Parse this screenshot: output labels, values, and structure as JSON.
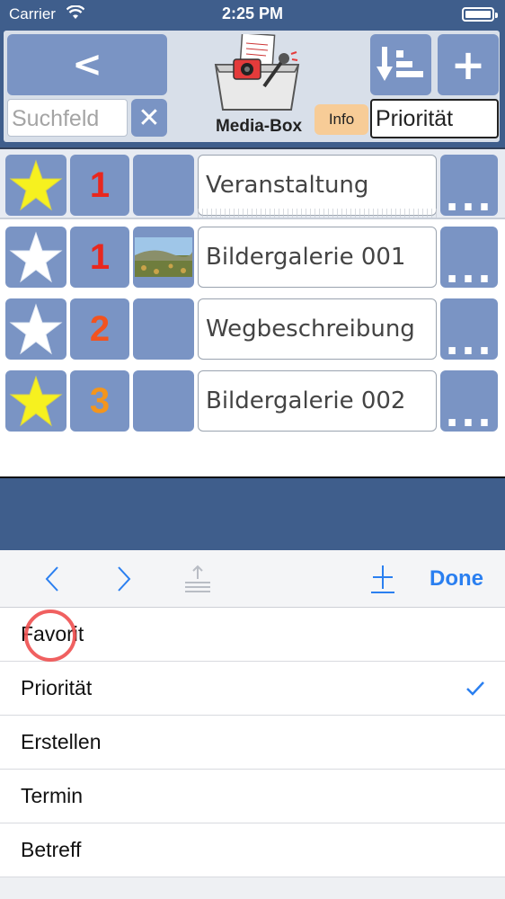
{
  "status_bar": {
    "carrier": "Carrier",
    "time": "2:25 PM"
  },
  "header": {
    "back_label": "<",
    "search_placeholder": "Suchfeld",
    "clear_label": "✕",
    "logo_caption": "Media-Box",
    "info_label": "Info",
    "add_label": "+",
    "sort_field_value": "Priorität"
  },
  "rows": [
    {
      "favorite": true,
      "priority": "1",
      "priority_color": "#e8271e",
      "has_image": false,
      "title": "Veranstaltung",
      "more": "..."
    },
    {
      "favorite": false,
      "priority": "1",
      "priority_color": "#e8271e",
      "has_image": true,
      "title": "Bildergalerie 001",
      "more": "..."
    },
    {
      "favorite": false,
      "priority": "2",
      "priority_color": "#f2531f",
      "has_image": false,
      "title": "Wegbeschreibung",
      "more": "..."
    },
    {
      "favorite": true,
      "priority": "3",
      "priority_color": "#f4951c",
      "has_image": false,
      "title": "Bildergalerie 002",
      "more": "..."
    }
  ],
  "toolbar": {
    "done_label": "Done"
  },
  "picker": {
    "options": [
      {
        "label": "Favorit",
        "selected": false
      },
      {
        "label": "Priorität",
        "selected": true
      },
      {
        "label": "Erstellen",
        "selected": false
      },
      {
        "label": "Termin",
        "selected": false
      },
      {
        "label": "Betreff",
        "selected": false
      }
    ]
  },
  "colors": {
    "nav_blue": "#3f5e8c",
    "button_blue": "#7a94c4",
    "info_orange": "#f7cc97",
    "ios_blue": "#2a7ff0",
    "star_yellow": "#f6f11f"
  }
}
